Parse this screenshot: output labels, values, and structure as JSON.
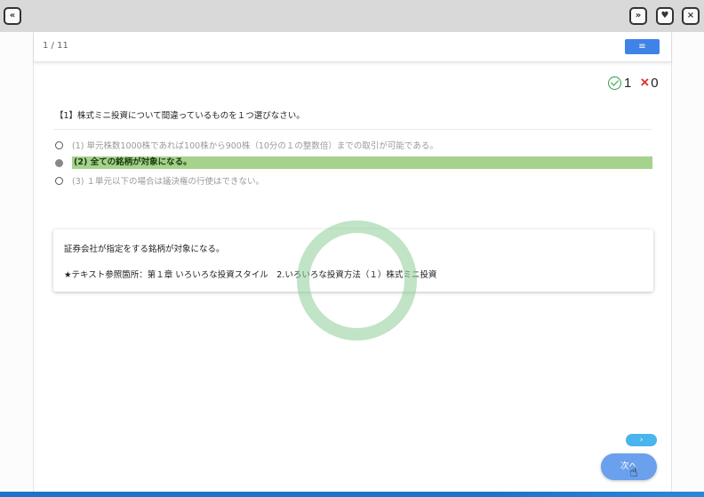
{
  "window": {
    "left_button": "«",
    "right_buttons": [
      "»",
      "♥",
      "×"
    ]
  },
  "header": {
    "page_count": "1 / 11",
    "menu_icon": "≡"
  },
  "score": {
    "correct_icon": "check-circle-icon",
    "correct": "1",
    "wrong_icon": "×",
    "wrong": "0",
    "colors": {
      "correct": "#2e9e4a",
      "wrong": "#dd3333"
    }
  },
  "question": {
    "text": "【1】株式ミニ投資について間違っているものを１つ選びなさい。",
    "options": [
      {
        "label": "(1) 単元株数1000株であれば100株から900株（10分の１の整数倍）までの取引が可能である。",
        "selected": false
      },
      {
        "label": "(2) 全ての銘柄が対象になる。",
        "selected": true
      },
      {
        "label": "(3) １単元以下の場合は議決権の行使はできない。",
        "selected": false
      }
    ],
    "highlight_color": "#a5d28c"
  },
  "explanation": {
    "line1": "証券会社が指定をする銘柄が対象になる。",
    "line2": "★テキスト参照箇所：第１章 いろいろな投資スタイル　2.いろいろな投資方法（１）株式ミニ投資"
  },
  "nav": {
    "small_next": "›",
    "next_label": "次へ"
  }
}
